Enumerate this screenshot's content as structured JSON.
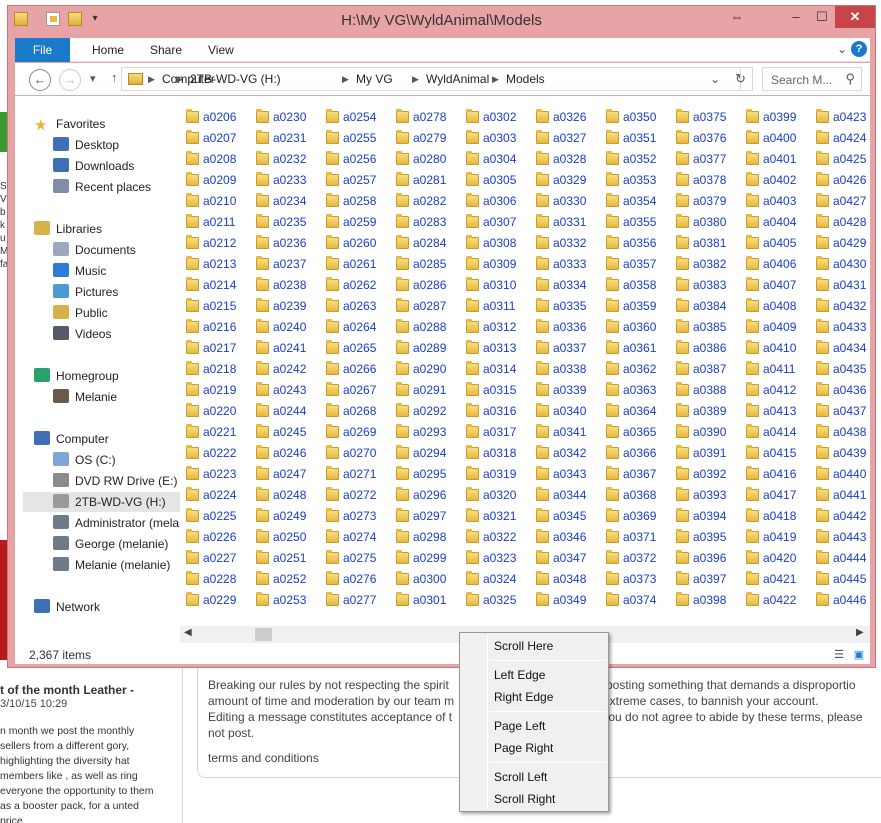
{
  "background": {
    "article_title": "t of the month Leather -",
    "article_date": "3/10/15 10:29",
    "article_body": "n month we post the monthly sellers from a different gory, highlighting the diversity hat members like , as well as ring everyone the opportunity to them as a booster pack, for a unted price",
    "edge_letters": "Si\nV\nb\nk\nu\nM\nfa",
    "terms_lines": [
      "Breaking our rules by not respecting the spirit",
      "amount of time and moderation by our team m",
      "Editing a message constitutes acceptance of t",
      "not post."
    ],
    "terms_lines_right": [
      "or posting something that demands a disproportio",
      "n extreme cases, to bannish your account.",
      "if you do not agree to abide by these terms, please",
      ""
    ],
    "terms_link": "terms and conditions"
  },
  "window": {
    "title": "H:\\My VG\\WyldAnimal\\Models",
    "buttons": {
      "restore": "⇔",
      "minimize": "–",
      "maximize": "☐",
      "close": "✕"
    }
  },
  "ribbon": {
    "tabs": [
      "File",
      "Home",
      "Share",
      "View"
    ],
    "expand_glyph": "⌄",
    "help_glyph": "?"
  },
  "address": {
    "back_glyph": "←",
    "forward_glyph": "→",
    "recent_glyph": "▾",
    "up_glyph": "↑",
    "crumbs": [
      "Computer",
      "2TB-WD-VG (H:)",
      "My VG",
      "WyldAnimal",
      "Models"
    ],
    "separator": "▶",
    "refresh_glyph": "↻",
    "dropdown_glyph": "⌄",
    "search_placeholder": "Search M...",
    "search_glyph": "⚲"
  },
  "nav": {
    "items": [
      {
        "label": "Favorites",
        "icon": "star-icon",
        "color": "#f0b030",
        "indent": 0
      },
      {
        "label": "Desktop",
        "icon": "desktop-icon",
        "color": "#3f6fb5",
        "indent": 1
      },
      {
        "label": "Downloads",
        "icon": "downloads-icon",
        "color": "#3f6fb5",
        "indent": 1
      },
      {
        "label": "Recent places",
        "icon": "recent-places-icon",
        "color": "#7d8fa8",
        "indent": 1
      },
      {
        "label": "Libraries",
        "icon": "libraries-icon",
        "color": "#d9b14a",
        "indent": 0
      },
      {
        "label": "Documents",
        "icon": "documents-icon",
        "color": "#9aa9bd",
        "indent": 1
      },
      {
        "label": "Music",
        "icon": "music-icon",
        "color": "#2e7bd6",
        "indent": 1
      },
      {
        "label": "Pictures",
        "icon": "pictures-icon",
        "color": "#4a9ad6",
        "indent": 1
      },
      {
        "label": "Public",
        "icon": "public-icon",
        "color": "#d9b14a",
        "indent": 1
      },
      {
        "label": "Videos",
        "icon": "videos-icon",
        "color": "#555b66",
        "indent": 1
      },
      {
        "label": "Homegroup",
        "icon": "homegroup-icon",
        "color": "#2aa06a",
        "indent": 0
      },
      {
        "label": "Melanie",
        "icon": "user-icon",
        "color": "#6b5a4a",
        "indent": 1
      },
      {
        "label": "Computer",
        "icon": "computer-icon",
        "color": "#3f6fb5",
        "indent": 0
      },
      {
        "label": "OS (C:)",
        "icon": "drive-c-icon",
        "color": "#7fa7d6",
        "indent": 1
      },
      {
        "label": "DVD RW Drive (E:) W",
        "icon": "dvd-drive-icon",
        "color": "#8a8a8a",
        "indent": 1
      },
      {
        "label": "2TB-WD-VG (H:)",
        "icon": "drive-h-icon",
        "color": "#9a9a9a",
        "indent": 1,
        "selected": true
      },
      {
        "label": "Administrator (mela",
        "icon": "network-drive-icon",
        "color": "#6e7a88",
        "indent": 1
      },
      {
        "label": "George (melanie)",
        "icon": "network-drive-icon",
        "color": "#6e7a88",
        "indent": 1
      },
      {
        "label": "Melanie (melanie)",
        "icon": "network-drive-icon",
        "color": "#6e7a88",
        "indent": 1
      },
      {
        "label": "Network",
        "icon": "network-icon",
        "color": "#3f6fb5",
        "indent": 0
      }
    ]
  },
  "folders": [
    [
      "a0206",
      "a0207",
      "a0208",
      "a0209",
      "a0210",
      "a0211",
      "a0212",
      "a0213",
      "a0214",
      "a0215",
      "a0216",
      "a0217",
      "a0218",
      "a0219",
      "a0220",
      "a0221",
      "a0222",
      "a0223",
      "a0224",
      "a0225",
      "a0226",
      "a0227",
      "a0228",
      "a0229"
    ],
    [
      "a0230",
      "a0231",
      "a0232",
      "a0233",
      "a0234",
      "a0235",
      "a0236",
      "a0237",
      "a0238",
      "a0239",
      "a0240",
      "a0241",
      "a0242",
      "a0243",
      "a0244",
      "a0245",
      "a0246",
      "a0247",
      "a0248",
      "a0249",
      "a0250",
      "a0251",
      "a0252",
      "a0253"
    ],
    [
      "a0254",
      "a0255",
      "a0256",
      "a0257",
      "a0258",
      "a0259",
      "a0260",
      "a0261",
      "a0262",
      "a0263",
      "a0264",
      "a0265",
      "a0266",
      "a0267",
      "a0268",
      "a0269",
      "a0270",
      "a0271",
      "a0272",
      "a0273",
      "a0274",
      "a0275",
      "a0276",
      "a0277"
    ],
    [
      "a0278",
      "a0279",
      "a0280",
      "a0281",
      "a0282",
      "a0283",
      "a0284",
      "a0285",
      "a0286",
      "a0287",
      "a0288",
      "a0289",
      "a0290",
      "a0291",
      "a0292",
      "a0293",
      "a0294",
      "a0295",
      "a0296",
      "a0297",
      "a0298",
      "a0299",
      "a0300",
      "a0301"
    ],
    [
      "a0302",
      "a0303",
      "a0304",
      "a0305",
      "a0306",
      "a0307",
      "a0308",
      "a0309",
      "a0310",
      "a0311",
      "a0312",
      "a0313",
      "a0314",
      "a0315",
      "a0316",
      "a0317",
      "a0318",
      "a0319",
      "a0320",
      "a0321",
      "a0322",
      "a0323",
      "a0324",
      "a0325"
    ],
    [
      "a0326",
      "a0327",
      "a0328",
      "a0329",
      "a0330",
      "a0331",
      "a0332",
      "a0333",
      "a0334",
      "a0335",
      "a0336",
      "a0337",
      "a0338",
      "a0339",
      "a0340",
      "a0341",
      "a0342",
      "a0343",
      "a0344",
      "a0345",
      "a0346",
      "a0347",
      "a0348",
      "a0349"
    ],
    [
      "a0350",
      "a0351",
      "a0352",
      "a0353",
      "a0354",
      "a0355",
      "a0356",
      "a0357",
      "a0358",
      "a0359",
      "a0360",
      "a0361",
      "a0362",
      "a0363",
      "a0364",
      "a0365",
      "a0366",
      "a0367",
      "a0368",
      "a0369",
      "a0371",
      "a0372",
      "a0373",
      "a0374"
    ],
    [
      "a0375",
      "a0376",
      "a0377",
      "a0378",
      "a0379",
      "a0380",
      "a0381",
      "a0382",
      "a0383",
      "a0384",
      "a0385",
      "a0386",
      "a0387",
      "a0388",
      "a0389",
      "a0390",
      "a0391",
      "a0392",
      "a0393",
      "a0394",
      "a0395",
      "a0396",
      "a0397",
      "a0398"
    ],
    [
      "a0399",
      "a0400",
      "a0401",
      "a0402",
      "a0403",
      "a0404",
      "a0405",
      "a0406",
      "a0407",
      "a0408",
      "a0409",
      "a0410",
      "a0411",
      "a0412",
      "a0413",
      "a0414",
      "a0415",
      "a0416",
      "a0417",
      "a0418",
      "a0419",
      "a0420",
      "a0421",
      "a0422"
    ],
    [
      "a0423",
      "a0424",
      "a0425",
      "a0426",
      "a0427",
      "a0428",
      "a0429",
      "a0430",
      "a0431",
      "a0432",
      "a0433",
      "a0434",
      "a0435",
      "a0436",
      "a0437",
      "a0438",
      "a0439",
      "a0440",
      "a0441",
      "a0442",
      "a0443",
      "a0444",
      "a0445",
      "a0446"
    ]
  ],
  "scrollbar": {
    "left_glyph": "◀",
    "right_glyph": "▶"
  },
  "status": {
    "item_count": "2,367 items",
    "details_view_glyph": "☰",
    "large_icons_glyph": "▣"
  },
  "context_menu": {
    "items": [
      "Scroll Here",
      "Left Edge",
      "Right Edge",
      "Page Left",
      "Page Right",
      "Scroll Left",
      "Scroll Right"
    ]
  },
  "colors": {
    "window_frame": "#e8a3a6",
    "file_tab": "#1979ca",
    "folder_text": "#1a3cc8",
    "close_button": "#c74549"
  }
}
